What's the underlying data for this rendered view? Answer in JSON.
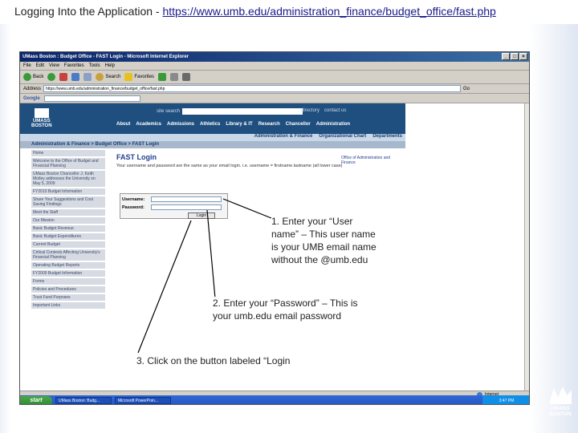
{
  "slide": {
    "title_prefix": "Logging Into the Application - ",
    "title_link": "https://www.umb.edu/administration_finance/budget_office/fast.php"
  },
  "window": {
    "title": "UMass Boston : Budget Office - FAST Login - Microsoft Internet Explorer",
    "menu": [
      "File",
      "Edit",
      "View",
      "Favorites",
      "Tools",
      "Help"
    ],
    "toolbar": [
      "Back",
      "Search",
      "Favorites"
    ],
    "address_label": "Address",
    "address": "https://www.umb.edu/administration_finance/budget_office/fast.php",
    "go": "Go",
    "google_label": "Google"
  },
  "site": {
    "search_label": "site search",
    "links": [
      "directory",
      "contact us"
    ],
    "logo_line1": "UMASS",
    "logo_line2": "BOSTON",
    "nav": [
      "About",
      "Academics",
      "Admissions",
      "Athletics",
      "Library & IT",
      "Research",
      "Chancellor",
      "Administration"
    ],
    "bluebar": [
      "Administration & Finance",
      "Organizational Chart",
      "Departments"
    ],
    "breadcrumb": "Administration & Finance > Budget Office > FAST Login",
    "sidenav": [
      "Home",
      "Welcome to the Office of Budget and Financial Planning",
      "UMass Boston Chancellor J. Keith Motley addresses the University on May 5, 2009",
      "FY2010 Budget Information",
      "Share Your Suggestions and Cost Saving Findings",
      "Meet the Staff",
      "Our Mission",
      "Basic Budget Revenue",
      "Basic Budget Expenditures",
      "Current Budget",
      "Critical Contexts Affecting University's Financial Planning",
      "Operating Budget Reports",
      "FY2009 Budget Information",
      "Forms",
      "Policies and Procedures",
      "Trust Fund Purposes",
      "Important Links"
    ],
    "page_heading": "FAST Login",
    "intro": "Your username and password are the same as your email login. i.e. username = firstname.lastname (all lower case)",
    "username_label": "Username:",
    "password_label": "Password:",
    "login_button": "Login",
    "right_box": "Office of Administration and Finance"
  },
  "statusbar": {
    "zone": "Internet"
  },
  "taskbar": {
    "start": "start",
    "items": [
      "UMass Boston: Budg...",
      "Microsoft PowerPoin..."
    ],
    "clock": "3:47 PM"
  },
  "callouts": {
    "step1": [
      "1. Enter your “User",
      "name” – This user name",
      "is your UMB email name",
      "without the @umb.edu"
    ],
    "step2": [
      "2. Enter your “Password” – This is",
      "your umb.edu email password"
    ],
    "step3": "3. Click on the button labeled “Login"
  },
  "brand": {
    "line1": "UMASS",
    "line2": "BOSTON"
  }
}
